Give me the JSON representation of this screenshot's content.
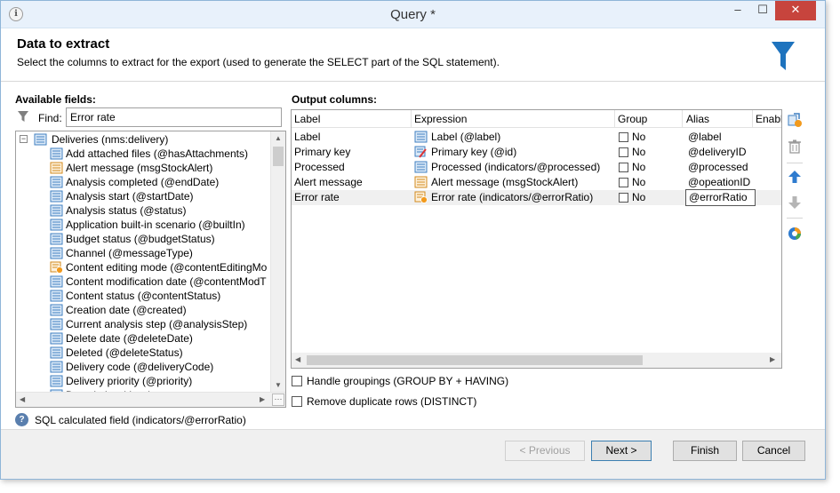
{
  "window": {
    "title": "Query *",
    "app_icon": "ℹ",
    "minimize": "–",
    "maximize": "☐",
    "close": "✕"
  },
  "header": {
    "title": "Data to extract",
    "description": "Select the columns to extract for the export (used to generate the SELECT part of the SQL statement).",
    "icon": "funnel-icon",
    "accent_color": "#1e73be"
  },
  "available": {
    "label": "Available fields:",
    "find_label": "Find:",
    "find_value": "Error rate",
    "root": {
      "expander": "−",
      "label": "Deliveries (nms:delivery)"
    },
    "items": [
      {
        "label": "Add attached files (@hasAttachments)",
        "icon": "field"
      },
      {
        "label": "Alert message (msgStockAlert)",
        "icon": "field-alt"
      },
      {
        "label": "Analysis completed (@endDate)",
        "icon": "field"
      },
      {
        "label": "Analysis start (@startDate)",
        "icon": "field"
      },
      {
        "label": "Analysis status (@status)",
        "icon": "field"
      },
      {
        "label": "Application built-in scenario (@builtIn)",
        "icon": "field"
      },
      {
        "label": "Budget status (@budgetStatus)",
        "icon": "field"
      },
      {
        "label": "Channel (@messageType)",
        "icon": "field"
      },
      {
        "label": "Content editing mode (@contentEditingMo",
        "icon": "calc"
      },
      {
        "label": "Content modification date (@contentModT",
        "icon": "field"
      },
      {
        "label": "Content status (@contentStatus)",
        "icon": "field"
      },
      {
        "label": "Creation date (@created)",
        "icon": "field"
      },
      {
        "label": "Current analysis step (@analysisStep)",
        "icon": "field"
      },
      {
        "label": "Delete date (@deleteDate)",
        "icon": "field"
      },
      {
        "label": "Deleted (@deleteStatus)",
        "icon": "field"
      },
      {
        "label": "Delivery code (@deliveryCode)",
        "icon": "field"
      },
      {
        "label": "Delivery priority (@priority)",
        "icon": "field"
      },
      {
        "label": "Description (desc)",
        "icon": "field"
      }
    ]
  },
  "output": {
    "label": "Output columns:",
    "columns": [
      "Label",
      "Expression",
      "Group",
      "Alias",
      "Enabl"
    ],
    "rows": [
      {
        "label": "Label",
        "expression": "Label (@label)",
        "expr_icon": "field",
        "group": "No",
        "alias": "@label"
      },
      {
        "label": "Primary key",
        "expression": "Primary key (@id)",
        "expr_icon": "key",
        "group": "No",
        "alias": "@deliveryID"
      },
      {
        "label": "Processed",
        "expression": "Processed (indicators/@processed)",
        "expr_icon": "field",
        "group": "No",
        "alias": "@processed"
      },
      {
        "label": "Alert message",
        "expression": "Alert message (msgStockAlert)",
        "expr_icon": "field-alt",
        "group": "No",
        "alias": "@opeationID"
      },
      {
        "label": "Error rate",
        "expression": "Error rate (indicators/@errorRatio)",
        "expr_icon": "calc",
        "group": "No",
        "alias": "@errorRatio"
      }
    ]
  },
  "options": {
    "handle_groupings": "Handle groupings (GROUP BY + HAVING)",
    "remove_duplicates": "Remove duplicate rows (DISTINCT)"
  },
  "status": {
    "help_icon": "?",
    "text": "SQL calculated field (indicators/@errorRatio)"
  },
  "buttons": {
    "previous": "< Previous",
    "next": "Next >",
    "finish": "Finish",
    "cancel": "Cancel"
  }
}
